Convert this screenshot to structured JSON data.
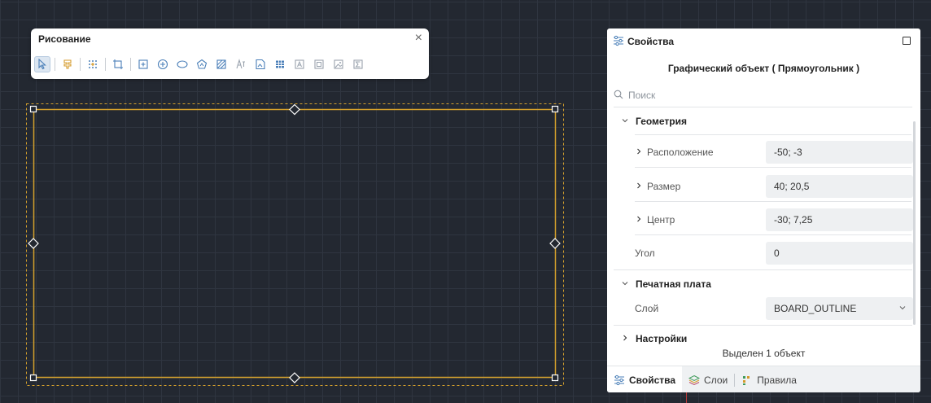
{
  "toolbar": {
    "title": "Рисование",
    "close_glyph": "×",
    "tools": [
      "select-pointer-icon",
      "pin-icon",
      "grid-points-icon",
      "frame-icon",
      "add-node-icon",
      "circle-plus-icon",
      "ellipse-icon",
      "polygon-icon",
      "hatch-icon",
      "text-tool-icon",
      "image-icon",
      "table-icon",
      "text-box-icon",
      "text-frame-icon",
      "picture-icon",
      "sum-icon"
    ]
  },
  "panel": {
    "title": "Свойства",
    "subtitle": "Графический объект ( Прямоугольник )",
    "search_placeholder": "Поиск",
    "geometry": {
      "title": "Геометрия",
      "rows": [
        {
          "label": "Расположение",
          "value": "-50; -3"
        },
        {
          "label": "Размер",
          "value": "40; 20,5"
        },
        {
          "label": "Центр",
          "value": "-30; 7,25"
        },
        {
          "label": "Угол",
          "value": "0"
        }
      ]
    },
    "pcb": {
      "title": "Печатная плата",
      "layer_label": "Слой",
      "layer_value": "BOARD_OUTLINE"
    },
    "settings_title": "Настройки",
    "status": "Выделен 1 объект",
    "tabs": [
      {
        "label": "Свойства",
        "icon": "sliders-icon"
      },
      {
        "label": "Слои",
        "icon": "layers-icon"
      },
      {
        "label": "Правила",
        "icon": "rules-icon"
      }
    ]
  },
  "colors": {
    "canvas_bg": "#232831",
    "grid": "#2f3540",
    "shape_outline": "#d4a02c",
    "accent": "#4a7fb8"
  }
}
